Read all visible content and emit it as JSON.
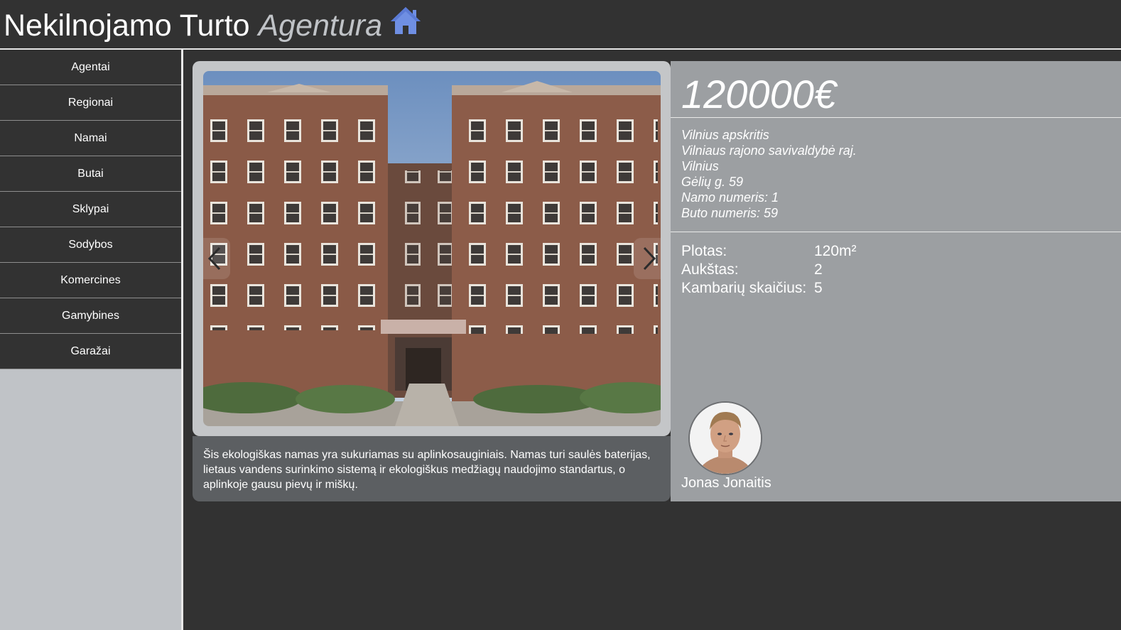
{
  "header": {
    "title_main": "Nekilnojamo Turto",
    "title_accent": "Agentura",
    "home_icon": "home-icon",
    "icon_color": "#6f8fe3"
  },
  "sidebar": {
    "items": [
      {
        "label": "Agentai"
      },
      {
        "label": "Regionai"
      },
      {
        "label": "Namai"
      },
      {
        "label": "Butai"
      },
      {
        "label": "Sklypai"
      },
      {
        "label": "Sodybos"
      },
      {
        "label": "Komercines"
      },
      {
        "label": "Gamybines"
      },
      {
        "label": "Garažai"
      }
    ]
  },
  "gallery": {
    "prev_icon": "chevron-left-icon",
    "next_icon": "chevron-right-icon"
  },
  "listing": {
    "price": "120000€",
    "address": {
      "region": "Vilnius apskritis",
      "municipality": "Vilniaus rajono savivaldybė raj.",
      "city": "Vilnius",
      "street": "Gėlių g. 59",
      "house_number": "Namo numeris: 1",
      "apartment_number": "Buto numeris: 59"
    },
    "specs": [
      {
        "label": "Plotas:",
        "value": "120m²"
      },
      {
        "label": "Aukštas:",
        "value": "2"
      },
      {
        "label": "Kambarių skaičius:",
        "value": "5"
      }
    ],
    "description": "Šis ekologiškas namas yra sukuriamas su aplinkosauginiais. Namas turi saulės baterijas, lietaus vandens surinkimo sistemą ir ekologiškus medžiagų naudojimo standartus, o aplinkoje gausu pievų ir miškų."
  },
  "agent": {
    "name": "Jonas Jonaitis"
  },
  "colors": {
    "background": "#323232",
    "sidebar": "#c0c3c7",
    "info_panel": "#9c9fa2",
    "description_panel": "#5c5f62"
  }
}
